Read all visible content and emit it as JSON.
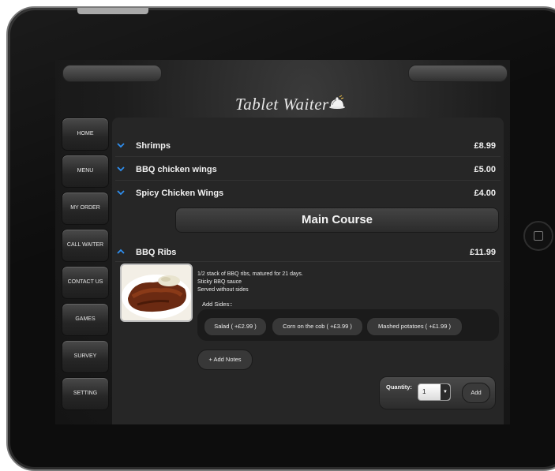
{
  "app": {
    "logo_text": "Tablet Waiter"
  },
  "nav": {
    "items": [
      {
        "label": "HOME"
      },
      {
        "label": "MENU"
      },
      {
        "label": "MY ORDER"
      },
      {
        "label": "CALL WAITER"
      },
      {
        "label": "CONTACT US"
      },
      {
        "label": "GAMES"
      },
      {
        "label": "SURVEY"
      },
      {
        "label": "SETTING"
      }
    ]
  },
  "menu": {
    "starters": [
      {
        "name": "Shrimps",
        "price": "£8.99"
      },
      {
        "name": "BBQ chicken wings",
        "price": "£5.00"
      },
      {
        "name": "Spicy Chicken Wings",
        "price": "£4.00"
      }
    ],
    "section_title": "Main Course",
    "expanded_item": {
      "name": "BBQ Ribs",
      "price": "£11.99",
      "description_lines": [
        "1/2 stack of BBQ ribs, matured for 21 days.",
        "Sticky BBQ sauce",
        "Served without sides"
      ],
      "sides_label": "Add Sides::",
      "sides": [
        {
          "label": "Salad ( +£2.99 )"
        },
        {
          "label": "Corn on the cob ( +£3.99 )"
        },
        {
          "label": "Mashed potatoes ( +£1.99 )"
        }
      ],
      "notes_label": "+ Add Notes",
      "quantity_label": "Quantity:",
      "quantity_value": "1",
      "add_label": "Add"
    }
  },
  "colors": {
    "accent_chevron": "#2f8ff0",
    "panel_bg": "#262626"
  },
  "icons": {
    "collapse_chevron": "chevron-down-icon",
    "expand_chevron": "chevron-up-icon",
    "logo_icon": "cloche-icon"
  }
}
